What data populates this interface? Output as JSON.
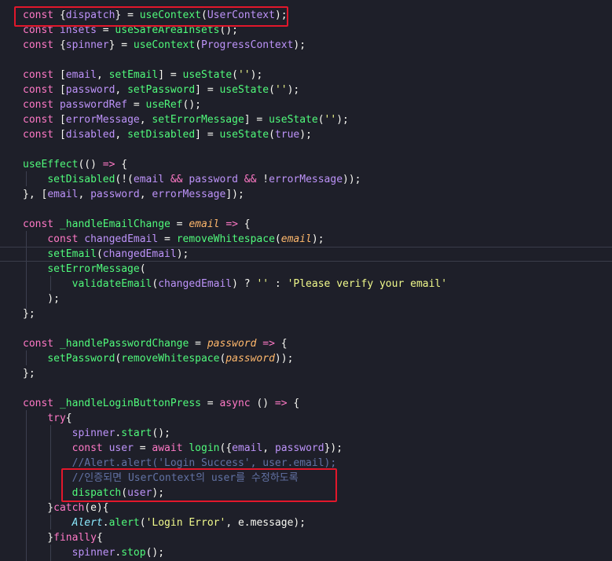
{
  "colors": {
    "kw": "#ff79c6",
    "fn": "#50fa7b",
    "param": "#ffb86c",
    "str": "#f1fa8c",
    "cmt": "#6272a4",
    "type": "#8be9fd",
    "var": "#bd93f9",
    "txt": "#f8f8f2"
  },
  "lines": [
    [
      [
        "kw",
        "const "
      ],
      [
        "txt",
        "{"
      ],
      [
        "var",
        "dispatch"
      ],
      [
        "txt",
        "} = "
      ],
      [
        "fn",
        "useContext"
      ],
      [
        "txt",
        "("
      ],
      [
        "var",
        "UserContext"
      ],
      [
        "txt",
        ");"
      ]
    ],
    [
      [
        "kw",
        "const "
      ],
      [
        "var",
        "insets"
      ],
      [
        "txt",
        " = "
      ],
      [
        "fn",
        "useSafeAreaInsets"
      ],
      [
        "txt",
        "();"
      ]
    ],
    [
      [
        "kw",
        "const "
      ],
      [
        "txt",
        "{"
      ],
      [
        "var",
        "spinner"
      ],
      [
        "txt",
        "} = "
      ],
      [
        "fn",
        "useContext"
      ],
      [
        "txt",
        "("
      ],
      [
        "var",
        "ProgressContext"
      ],
      [
        "txt",
        ");"
      ]
    ],
    [],
    [
      [
        "kw",
        "const "
      ],
      [
        "txt",
        "["
      ],
      [
        "var",
        "email"
      ],
      [
        "txt",
        ", "
      ],
      [
        "fn",
        "setEmail"
      ],
      [
        "txt",
        "] = "
      ],
      [
        "fn",
        "useState"
      ],
      [
        "txt",
        "("
      ],
      [
        "str",
        "''"
      ],
      [
        "txt",
        ");"
      ]
    ],
    [
      [
        "kw",
        "const "
      ],
      [
        "txt",
        "["
      ],
      [
        "var",
        "password"
      ],
      [
        "txt",
        ", "
      ],
      [
        "fn",
        "setPassword"
      ],
      [
        "txt",
        "] = "
      ],
      [
        "fn",
        "useState"
      ],
      [
        "txt",
        "("
      ],
      [
        "str",
        "''"
      ],
      [
        "txt",
        ");"
      ]
    ],
    [
      [
        "kw",
        "const "
      ],
      [
        "var",
        "passwordRef"
      ],
      [
        "txt",
        " = "
      ],
      [
        "fn",
        "useRef"
      ],
      [
        "txt",
        "();"
      ]
    ],
    [
      [
        "kw",
        "const "
      ],
      [
        "txt",
        "["
      ],
      [
        "var",
        "errorMessage"
      ],
      [
        "txt",
        ", "
      ],
      [
        "fn",
        "setErrorMessage"
      ],
      [
        "txt",
        "] = "
      ],
      [
        "fn",
        "useState"
      ],
      [
        "txt",
        "("
      ],
      [
        "str",
        "''"
      ],
      [
        "txt",
        ");"
      ]
    ],
    [
      [
        "kw",
        "const "
      ],
      [
        "txt",
        "["
      ],
      [
        "var",
        "disabled"
      ],
      [
        "txt",
        ", "
      ],
      [
        "fn",
        "setDisabled"
      ],
      [
        "txt",
        "] = "
      ],
      [
        "fn",
        "useState"
      ],
      [
        "txt",
        "("
      ],
      [
        "var",
        "true"
      ],
      [
        "txt",
        ");"
      ]
    ],
    [],
    [
      [
        "fn",
        "useEffect"
      ],
      [
        "txt",
        "(() "
      ],
      [
        "kw",
        "=>"
      ],
      [
        "txt",
        " {"
      ]
    ],
    [
      [
        "txt",
        "    "
      ],
      [
        "fn",
        "setDisabled"
      ],
      [
        "txt",
        "(!("
      ],
      [
        "var",
        "email"
      ],
      [
        "txt",
        " "
      ],
      [
        "kw",
        "&&"
      ],
      [
        "txt",
        " "
      ],
      [
        "var",
        "password"
      ],
      [
        "txt",
        " "
      ],
      [
        "kw",
        "&&"
      ],
      [
        "txt",
        " !"
      ],
      [
        "var",
        "errorMessage"
      ],
      [
        "txt",
        "));"
      ]
    ],
    [
      [
        "txt",
        "}, ["
      ],
      [
        "var",
        "email"
      ],
      [
        "txt",
        ", "
      ],
      [
        "var",
        "password"
      ],
      [
        "txt",
        ", "
      ],
      [
        "var",
        "errorMessage"
      ],
      [
        "txt",
        "]);"
      ]
    ],
    [],
    [
      [
        "kw",
        "const "
      ],
      [
        "fn",
        "_handleEmailChange"
      ],
      [
        "txt",
        " = "
      ],
      [
        "param",
        "email"
      ],
      [
        "txt",
        " "
      ],
      [
        "kw",
        "=>"
      ],
      [
        "txt",
        " {"
      ]
    ],
    [
      [
        "txt",
        "    "
      ],
      [
        "kw",
        "const "
      ],
      [
        "var",
        "changedEmail"
      ],
      [
        "txt",
        " = "
      ],
      [
        "fn",
        "removeWhitespace"
      ],
      [
        "txt",
        "("
      ],
      [
        "param",
        "email"
      ],
      [
        "txt",
        ");"
      ]
    ],
    [
      [
        "txt",
        "    "
      ],
      [
        "fn",
        "setEmail"
      ],
      [
        "txt",
        "("
      ],
      [
        "var",
        "changedEmail"
      ],
      [
        "txt",
        ");"
      ]
    ],
    [
      [
        "txt",
        "    "
      ],
      [
        "fn",
        "setErrorMessage"
      ],
      [
        "txt",
        "("
      ]
    ],
    [
      [
        "txt",
        "        "
      ],
      [
        "fn",
        "validateEmail"
      ],
      [
        "txt",
        "("
      ],
      [
        "var",
        "changedEmail"
      ],
      [
        "txt",
        ") ? "
      ],
      [
        "str",
        "''"
      ],
      [
        "txt",
        " : "
      ],
      [
        "str",
        "'Please verify your email'"
      ]
    ],
    [
      [
        "txt",
        "    );"
      ]
    ],
    [
      [
        "txt",
        "};"
      ]
    ],
    [],
    [
      [
        "kw",
        "const "
      ],
      [
        "fn",
        "_handlePasswordChange"
      ],
      [
        "txt",
        " = "
      ],
      [
        "param",
        "password"
      ],
      [
        "txt",
        " "
      ],
      [
        "kw",
        "=>"
      ],
      [
        "txt",
        " {"
      ]
    ],
    [
      [
        "txt",
        "    "
      ],
      [
        "fn",
        "setPassword"
      ],
      [
        "txt",
        "("
      ],
      [
        "fn",
        "removeWhitespace"
      ],
      [
        "txt",
        "("
      ],
      [
        "param",
        "password"
      ],
      [
        "txt",
        "));"
      ]
    ],
    [
      [
        "txt",
        "};"
      ]
    ],
    [],
    [
      [
        "kw",
        "const "
      ],
      [
        "fn",
        "_handleLoginButtonPress"
      ],
      [
        "txt",
        " = "
      ],
      [
        "kw",
        "async"
      ],
      [
        "txt",
        " () "
      ],
      [
        "kw",
        "=>"
      ],
      [
        "txt",
        " {"
      ]
    ],
    [
      [
        "txt",
        "    "
      ],
      [
        "kw",
        "try"
      ],
      [
        "txt",
        "{"
      ]
    ],
    [
      [
        "txt",
        "        "
      ],
      [
        "var",
        "spinner"
      ],
      [
        "txt",
        "."
      ],
      [
        "fn",
        "start"
      ],
      [
        "txt",
        "();"
      ]
    ],
    [
      [
        "txt",
        "        "
      ],
      [
        "kw",
        "const "
      ],
      [
        "var",
        "user"
      ],
      [
        "txt",
        " = "
      ],
      [
        "kw",
        "await "
      ],
      [
        "fn",
        "login"
      ],
      [
        "txt",
        "({"
      ],
      [
        "var",
        "email"
      ],
      [
        "txt",
        ", "
      ],
      [
        "var",
        "password"
      ],
      [
        "txt",
        "});"
      ]
    ],
    [
      [
        "txt",
        "        "
      ],
      [
        "cmt",
        "//Alert.alert('Login Success', user.email);"
      ]
    ],
    [
      [
        "txt",
        "        "
      ],
      [
        "cmt",
        "//인증되면 UserContext의 user를 수정하도록"
      ]
    ],
    [
      [
        "txt",
        "        "
      ],
      [
        "fn",
        "dispatch"
      ],
      [
        "txt",
        "("
      ],
      [
        "var",
        "user"
      ],
      [
        "txt",
        ");"
      ]
    ],
    [
      [
        "txt",
        "    }"
      ],
      [
        "kw",
        "catch"
      ],
      [
        "txt",
        "(e){"
      ]
    ],
    [
      [
        "txt",
        "        "
      ],
      [
        "type",
        "Alert"
      ],
      [
        "txt",
        "."
      ],
      [
        "fn",
        "alert"
      ],
      [
        "txt",
        "("
      ],
      [
        "str",
        "'Login Error'"
      ],
      [
        "txt",
        ", e.message);"
      ]
    ],
    [
      [
        "txt",
        "    }"
      ],
      [
        "kw",
        "finally"
      ],
      [
        "txt",
        "{"
      ]
    ],
    [
      [
        "txt",
        "        "
      ],
      [
        "var",
        "spinner"
      ],
      [
        "txt",
        "."
      ],
      [
        "fn",
        "stop"
      ],
      [
        "txt",
        "();"
      ]
    ]
  ]
}
